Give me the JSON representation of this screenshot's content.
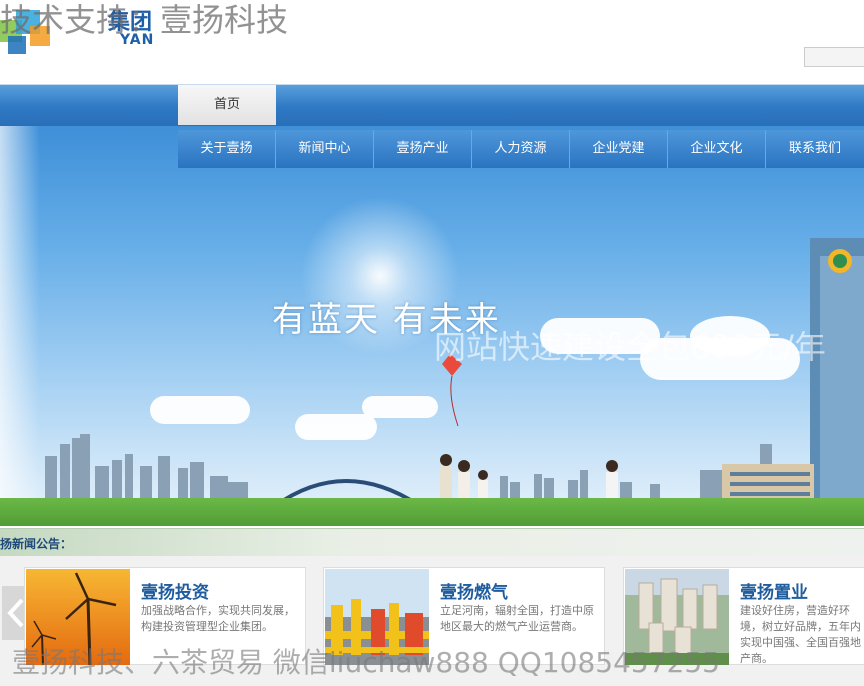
{
  "watermarks": {
    "top": "技术支持：壹扬科技",
    "middle": "网站快速建设全包600元/年",
    "bottom": "壹扬科技、六茶贸易 微信liuchaw888 QQ1085457255"
  },
  "logo": {
    "text": "集团",
    "sub": "YAN"
  },
  "nav": {
    "home": "首页"
  },
  "subnav": [
    "关于壹扬",
    "新闻中心",
    "壹扬产业",
    "人力资源",
    "企业党建",
    "企业文化",
    "联系我们"
  ],
  "banner": {
    "slogan": "有蓝天   有未来"
  },
  "news": {
    "label": "扬新闻公告："
  },
  "cards": [
    {
      "title": "壹扬投资",
      "desc": "加强战略合作，实现共同发展，构建投资管理型企业集团。",
      "icon": "wind-turbine-image"
    },
    {
      "title": "壹扬燃气",
      "desc": "立足河南，辐射全国，打造中原地区最大的燃气产业运营商。",
      "icon": "gas-pipeline-image"
    },
    {
      "title": "壹扬置业",
      "desc": "建设好住房，营造好环境，树立好品牌，五年内实现中国强、全国百强地产商。",
      "icon": "residential-building-image"
    }
  ],
  "colors": {
    "nav_blue": "#2e78c4",
    "title_blue": "#1f5d9f"
  }
}
